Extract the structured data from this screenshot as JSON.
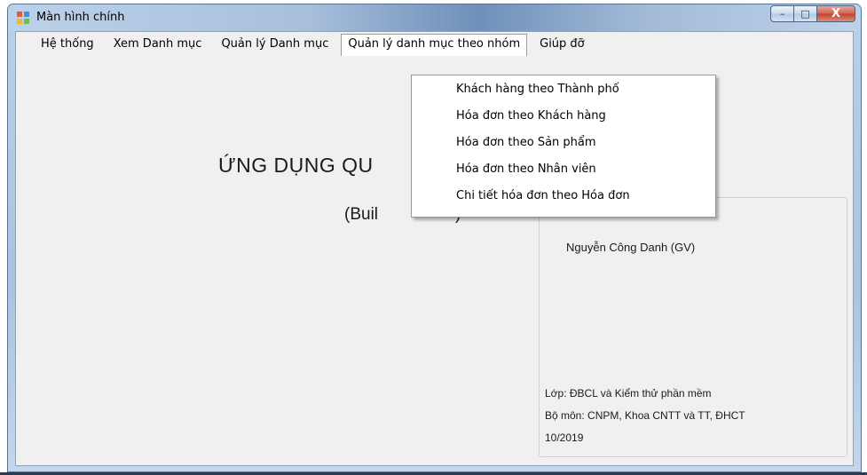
{
  "window": {
    "title": "Màn hình chính",
    "icon": "app-form-icon",
    "caption": {
      "minimize": "–",
      "maximize": "□",
      "close": "X"
    }
  },
  "menubar": {
    "items": [
      {
        "label": "Hệ thống"
      },
      {
        "label": "Xem Danh mục"
      },
      {
        "label": "Quản lý Danh mục"
      },
      {
        "label": "Quản lý danh mục theo nhóm",
        "open": true
      },
      {
        "label": "Giúp đỡ"
      }
    ]
  },
  "dropdown": {
    "items": [
      {
        "label": "Khách hàng theo Thành phố"
      },
      {
        "label": "Hóa đơn theo Khách hàng"
      },
      {
        "label": "Hóa đơn theo Sản phẩm"
      },
      {
        "label": "Hóa đơn theo Nhân viên"
      },
      {
        "label": "Chi tiết hóa đơn theo Hóa đơn"
      }
    ]
  },
  "main": {
    "app_title_visible": "ỨNG DỤNG QU",
    "built_visible": "(Buil",
    "built_tail_visible": ")"
  },
  "info": {
    "author": "Nguyễn Công Danh (GV)",
    "class": "Lớp: ĐBCL và Kiểm thử phần mềm",
    "department": "Bộ môn: CNPM, Khoa CNTT và TT, ĐHCT",
    "date": "10/2019"
  },
  "colors": {
    "client_bg": "#f0f0f0",
    "close_button": "#c2412d",
    "titlebar": "#a9c3e0"
  }
}
